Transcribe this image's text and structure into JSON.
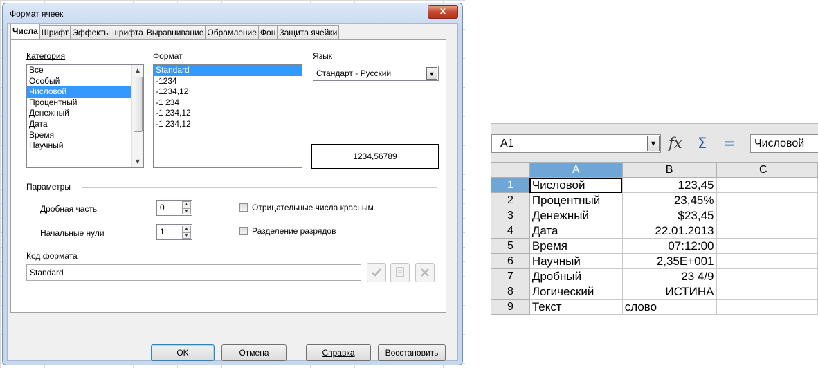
{
  "dialog": {
    "title": "Формат ячеек",
    "close_glyph": "x",
    "tabs": [
      {
        "label": "Числа",
        "active": true
      },
      {
        "label": "Шрифт",
        "active": false
      },
      {
        "label": "Эффекты шрифта",
        "active": false
      },
      {
        "label": "Выравнивание",
        "active": false
      },
      {
        "label": "Обрамление",
        "active": false
      },
      {
        "label": "Фон",
        "active": false
      },
      {
        "label": "Защита ячейки",
        "active": false
      }
    ],
    "category": {
      "label": "Категория",
      "items": [
        "Все",
        "Особый",
        "Числовой",
        "Процентный",
        "Денежный",
        "Дата",
        "Время",
        "Научный"
      ],
      "selected": "Числовой"
    },
    "format": {
      "label": "Формат",
      "items": [
        "Standard",
        "-1234",
        "-1234,12",
        "-1 234",
        "-1 234,12",
        "-1 234,12"
      ],
      "selected": "Standard"
    },
    "language": {
      "label": "Язык",
      "value": "Стандарт - Русский"
    },
    "preview_value": "1234,56789",
    "params": {
      "label": "Параметры",
      "decimals_label": "Дробная часть",
      "decimals_value": "0",
      "leading_zeros_label": "Начальные нули",
      "leading_zeros_value": "1",
      "negative_red_label": "Отрицательные числа красным",
      "negative_red_checked": false,
      "thousands_sep_label": "Разделение разрядов",
      "thousands_sep_checked": false
    },
    "format_code": {
      "label": "Код формата",
      "value": "Standard"
    },
    "buttons": {
      "ok": "OK",
      "cancel": "Отмена",
      "help": "Справка",
      "reset": "Восстановить"
    }
  },
  "spreadsheet": {
    "name_box": "A1",
    "formula_value": "Числовой",
    "toolbar_icons": [
      "function-wizard-icon",
      "sum-icon",
      "equals-icon"
    ],
    "columns": [
      "A",
      "B",
      "C"
    ],
    "selected_column": "A",
    "rows": [
      {
        "num": "1",
        "a": "Числовой",
        "b": "123,45"
      },
      {
        "num": "2",
        "a": "Процентный",
        "b": "23,45%"
      },
      {
        "num": "3",
        "a": "Денежный",
        "b": "$23,45"
      },
      {
        "num": "4",
        "a": "Дата",
        "b": "22.01.2013"
      },
      {
        "num": "5",
        "a": "Время",
        "b": "07:12:00"
      },
      {
        "num": "6",
        "a": "Научный",
        "b": "2,35E+001"
      },
      {
        "num": "7",
        "a": "Дробный",
        "b": "23 4/9"
      },
      {
        "num": "8",
        "a": "Логический",
        "b": "ИСТИНА"
      },
      {
        "num": "9",
        "a": "Текст",
        "b": "слово"
      }
    ],
    "active_cell": "A1"
  }
}
